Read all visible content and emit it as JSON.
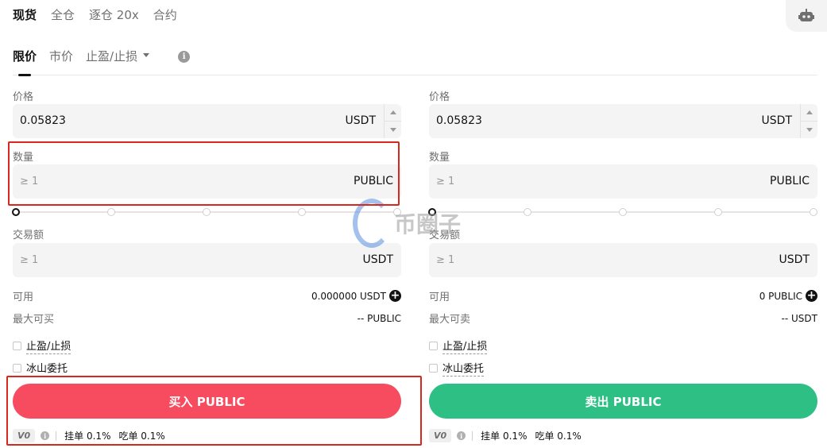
{
  "top_tabs": [
    "现货",
    "全仓",
    "逐仓 20x",
    "合约"
  ],
  "order_tabs": {
    "limit": "限价",
    "market": "市价",
    "tpsl": "止盈/止损"
  },
  "buy": {
    "price_label": "价格",
    "price_value": "0.05823",
    "price_unit": "USDT",
    "qty_label": "数量",
    "qty_placeholder": "≥ 1",
    "qty_unit": "PUBLIC",
    "total_label": "交易额",
    "total_placeholder": "≥ 1",
    "total_unit": "USDT",
    "available_label": "可用",
    "available_value": "0.000000 USDT",
    "max_label": "最大可买",
    "max_value": "-- PUBLIC",
    "tpsl_label": "止盈/止损",
    "iceberg_label": "冰山委托",
    "action_label": "买入 PUBLIC",
    "vip_label": "V0",
    "maker_fee": "挂单 0.1%",
    "taker_fee": "吃单 0.1%"
  },
  "sell": {
    "price_label": "价格",
    "price_value": "0.05823",
    "price_unit": "USDT",
    "qty_label": "数量",
    "qty_placeholder": "≥ 1",
    "qty_unit": "PUBLIC",
    "total_label": "交易额",
    "total_placeholder": "≥ 1",
    "total_unit": "USDT",
    "available_label": "可用",
    "available_value": "0 PUBLIC",
    "max_label": "最大可卖",
    "max_value": "-- USDT",
    "tpsl_label": "止盈/止损",
    "iceberg_label": "冰山委托",
    "action_label": "卖出 PUBLIC",
    "vip_label": "V0",
    "maker_fee": "挂单 0.1%",
    "taker_fee": "吃单 0.1%"
  },
  "watermark": "币圈子",
  "colors": {
    "buy": "#f74b60",
    "sell": "#2dbf84",
    "highlight": "#d8281e"
  }
}
